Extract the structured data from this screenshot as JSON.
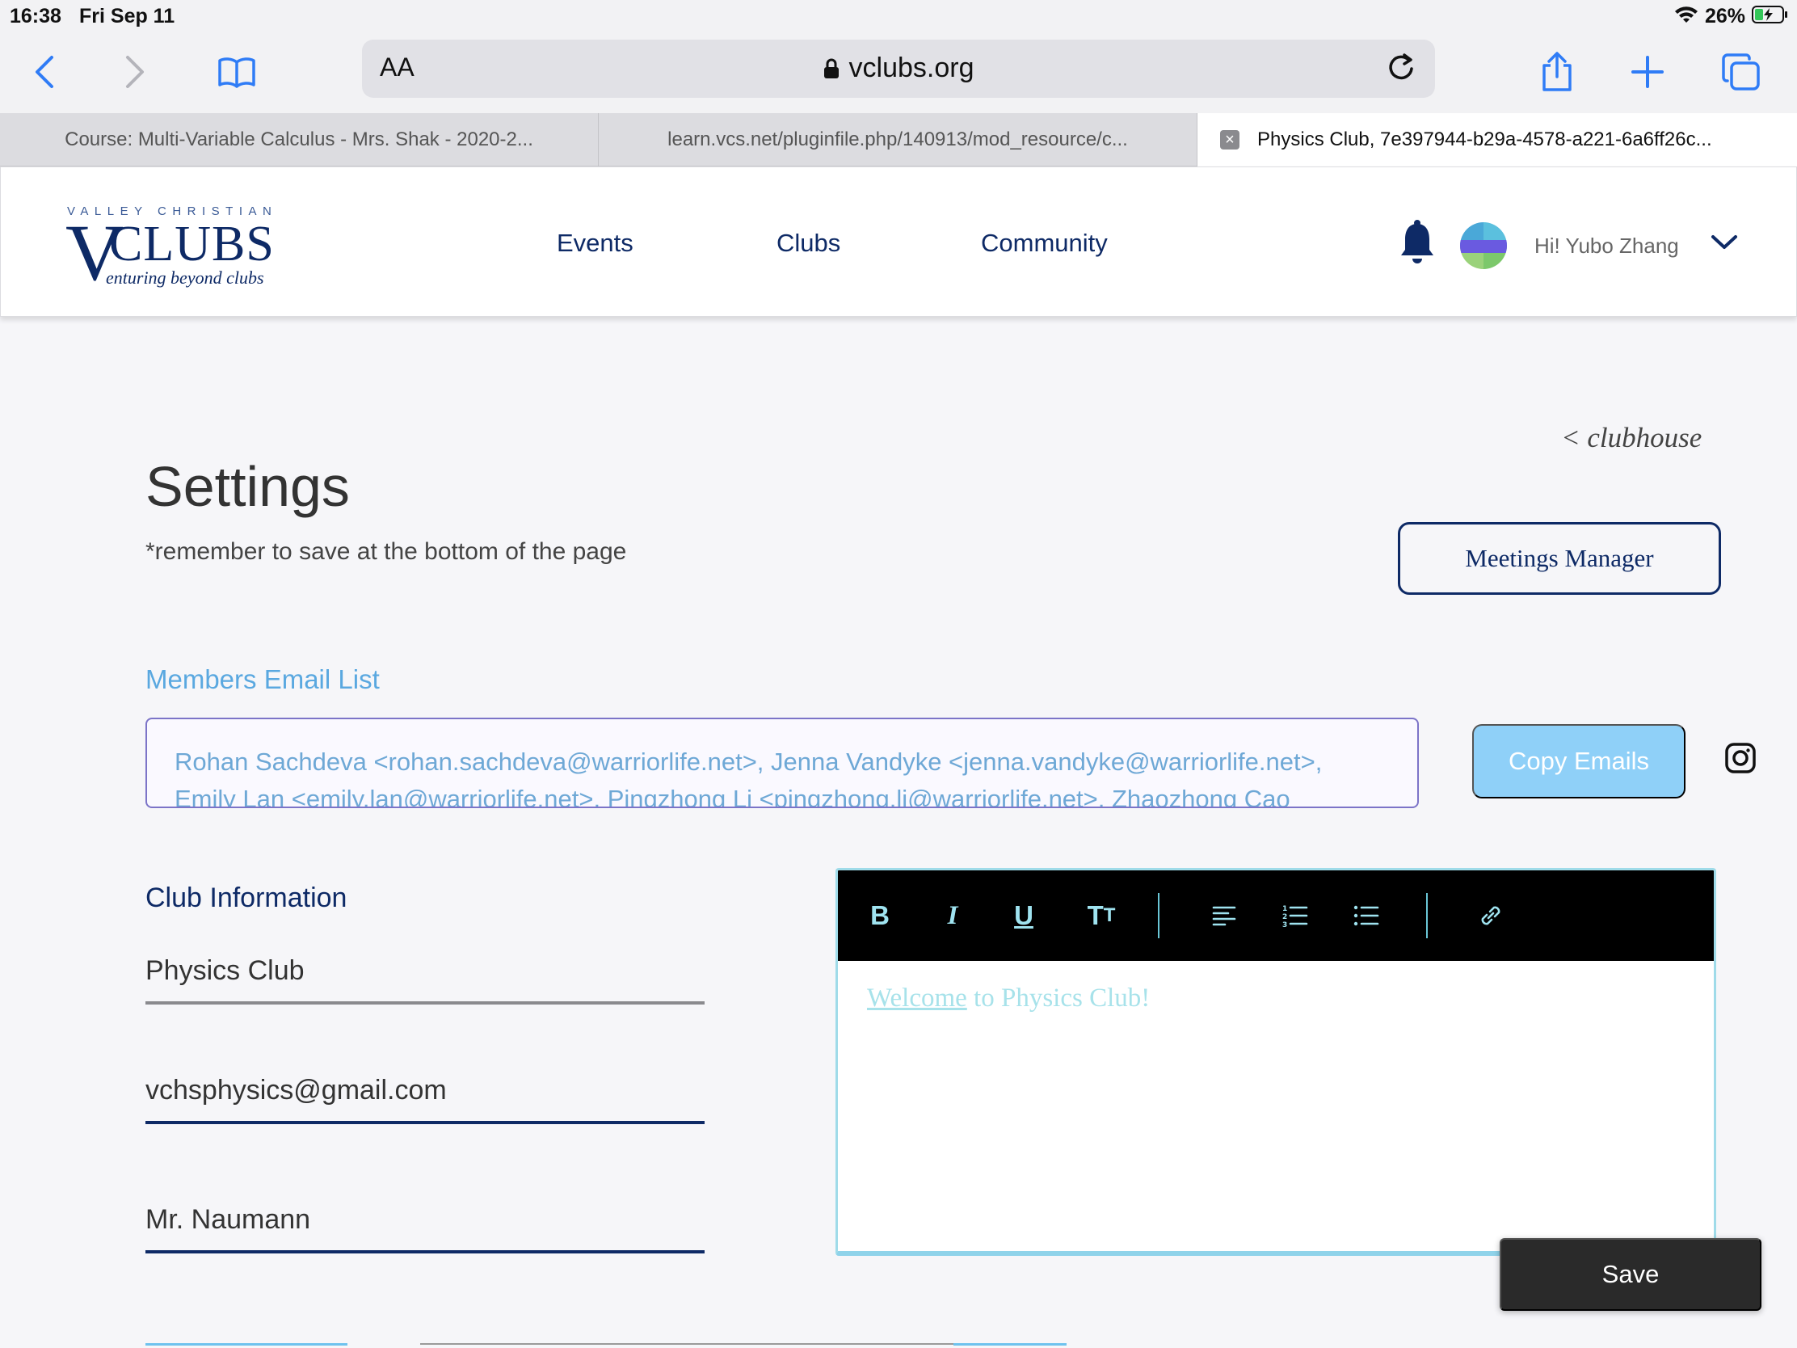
{
  "status_bar": {
    "time": "16:38",
    "date": "Fri Sep 11",
    "battery": "26%"
  },
  "browser": {
    "url": "vclubs.org",
    "text_size_label": "AA",
    "tabs": [
      {
        "label": "Course: Multi-Variable Calculus - Mrs. Shak - 2020-2...",
        "active": false
      },
      {
        "label": "learn.vcs.net/pluginfile.php/140913/mod_resource/c...",
        "active": false
      },
      {
        "label": "Physics Club, 7e397944-b29a-4578-a221-6a6ff26c...",
        "active": true
      }
    ]
  },
  "header": {
    "logo": {
      "top": "VALLEY CHRISTIAN",
      "v": "V",
      "main": "CLUBS",
      "tagline": "enturing beyond clubs"
    },
    "nav": [
      "Events",
      "Clubs",
      "Community"
    ],
    "greeting": "Hi! Yubo Zhang"
  },
  "page": {
    "back_link": "< clubhouse",
    "title": "Settings",
    "reminder": "*remember to save at the bottom of the page",
    "meetings_button": "Meetings Manager",
    "members_label": "Members Email List",
    "members_emails_line1": "Rohan Sachdeva <rohan.sachdeva@warriorlife.net>, Jenna Vandyke <jenna.vandyke@warriorlife.net>,",
    "members_emails_line2": "Emily Lan <emily.lan@warriorlife.net>, Pingzhong Li <pingzhong.li@warriorlife.net>, Zhaozhong Cao",
    "copy_button": "Copy Emails",
    "club_info_heading": "Club Information",
    "club_name": "Physics Club",
    "club_email": "vchsphysics@gmail.com",
    "club_advisor": "Mr. Naumann",
    "editor": {
      "content_link": "Welcome",
      "content_rest": " to Physics Club!"
    },
    "save_button": "Save"
  },
  "colors": {
    "navy": "#0e2a66",
    "accent_blue": "#5aa8e0",
    "copy_button": "#8fd0f8",
    "editor_text": "#a7e2ea"
  }
}
